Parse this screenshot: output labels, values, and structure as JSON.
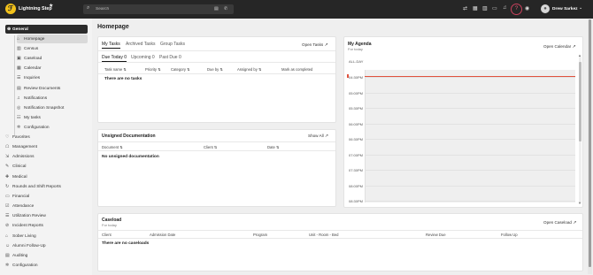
{
  "app": {
    "name": "Lightning Step",
    "search_placeholder": "Search",
    "user_name": "Drew Sarkez"
  },
  "sidebar": {
    "general_label": "General",
    "general_items": [
      {
        "label": "Homepage",
        "icon": "home-icon"
      },
      {
        "label": "Census",
        "icon": "chart-icon"
      },
      {
        "label": "Caseload",
        "icon": "briefcase-icon"
      },
      {
        "label": "Calendar",
        "icon": "calendar-icon"
      },
      {
        "label": "Inquiries",
        "icon": "inquiries-icon"
      },
      {
        "label": "Review Documents",
        "icon": "document-icon"
      },
      {
        "label": "Notifications",
        "icon": "bell-icon"
      },
      {
        "label": "Notification Snapshot",
        "icon": "snapshot-icon"
      },
      {
        "label": "My tasks",
        "icon": "tasks-icon"
      },
      {
        "label": "Configuration",
        "icon": "gear-icon"
      }
    ],
    "sections": [
      {
        "label": "Favorites",
        "icon": "heart-icon"
      },
      {
        "label": "Management",
        "icon": "management-icon"
      },
      {
        "label": "Admissions",
        "icon": "admissions-icon"
      },
      {
        "label": "Clinical",
        "icon": "clinical-icon"
      },
      {
        "label": "Medical",
        "icon": "medical-icon"
      },
      {
        "label": "Rounds and Shift Reports",
        "icon": "rounds-icon"
      },
      {
        "label": "Financial",
        "icon": "financial-icon"
      },
      {
        "label": "Attendance",
        "icon": "attendance-icon"
      },
      {
        "label": "Utilization Review",
        "icon": "review-icon"
      },
      {
        "label": "Incident Reports",
        "icon": "incident-icon"
      },
      {
        "label": "Sober Living",
        "icon": "house-icon"
      },
      {
        "label": "Alumni Follow-Up",
        "icon": "alumni-icon"
      },
      {
        "label": "Auditing",
        "icon": "audit-icon"
      },
      {
        "label": "Configuration",
        "icon": "gear-icon"
      }
    ]
  },
  "main": {
    "title": "Homepage",
    "tasks": {
      "tabs": [
        "My Tasks",
        "Archived Tasks",
        "Group Tasks"
      ],
      "open_link": "Open Tasks",
      "subtabs": [
        "Due Today 0",
        "Upcoming 0",
        "Past Due 0"
      ],
      "columns": [
        "Task name",
        "Priority",
        "Category",
        "Due by",
        "Assigned by",
        "Mark as completed"
      ],
      "empty": "There are no tasks"
    },
    "unsigned": {
      "title": "Unsigned Documentation",
      "show_all": "Show All",
      "columns": [
        "Document",
        "Client",
        "Date"
      ],
      "empty": "No unsigned documentation"
    },
    "agenda": {
      "title": "My Agenda",
      "subtitle": "For today",
      "open_link": "Open Calendar",
      "all_day": "ALL-DAY",
      "times": [
        "04:30PM",
        "05:00PM",
        "05:30PM",
        "06:00PM",
        "06:30PM",
        "07:00PM",
        "07:30PM",
        "08:00PM",
        "08:30PM"
      ]
    },
    "caseload": {
      "title": "Caseload",
      "subtitle": "For today",
      "open_link": "Open Caseload",
      "columns": [
        "Client",
        "Admission Date",
        "Program",
        "Unit - Room - Bed",
        "Review Due",
        "Follow Up"
      ],
      "empty": "There are no caseloads"
    }
  }
}
